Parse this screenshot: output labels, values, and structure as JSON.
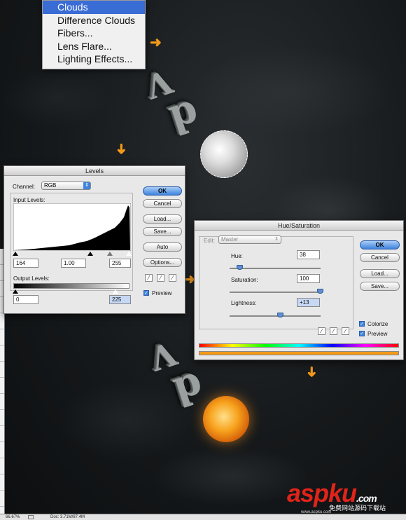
{
  "filter_menu": {
    "items": [
      {
        "label": "Clouds",
        "active": true
      },
      {
        "label": "Difference Clouds",
        "active": false
      },
      {
        "label": "Fibers...",
        "active": false
      },
      {
        "label": "Lens Flare...",
        "active": false
      },
      {
        "label": "Lighting Effects...",
        "active": false
      }
    ]
  },
  "levels_dialog": {
    "title": "Levels",
    "channel_label": "Channel:",
    "channel_value": "RGB",
    "input_levels_label": "Input Levels:",
    "input_levels": [
      "164",
      "1.00",
      "255"
    ],
    "output_levels_label": "Output Levels:",
    "output_levels": [
      "0",
      "225"
    ],
    "buttons": {
      "ok": "OK",
      "cancel": "Cancel",
      "load": "Load...",
      "save": "Save...",
      "auto": "Auto",
      "options": "Options..."
    },
    "preview_label": "Preview",
    "preview_checked": true
  },
  "hue_saturation_dialog": {
    "title": "Hue/Saturation",
    "edit_label": "Edit:",
    "edit_value": "Master",
    "hue_label": "Hue:",
    "hue_value": "38",
    "saturation_label": "Saturation:",
    "saturation_value": "100",
    "lightness_label": "Lightness:",
    "lightness_value": "+13",
    "buttons": {
      "ok": "OK",
      "cancel": "Cancel",
      "load": "Load...",
      "save": "Save..."
    },
    "colorize_label": "Colorize",
    "colorize_checked": true,
    "preview_label": "Preview",
    "preview_checked": true
  },
  "status_bar": {
    "zoom": "66.67%",
    "doc": "Doc: 3.71M/87.4M"
  },
  "watermark": {
    "brand": "aspku",
    "suffix": ".com",
    "tagline": "免费网站源码下载站",
    "url": "www.aspku.com"
  },
  "colors": {
    "accent": "#3e83de",
    "arrow": "#f39a1a",
    "menu_highlight": "#3a6cd6",
    "watermark_red": "#e0241a"
  }
}
